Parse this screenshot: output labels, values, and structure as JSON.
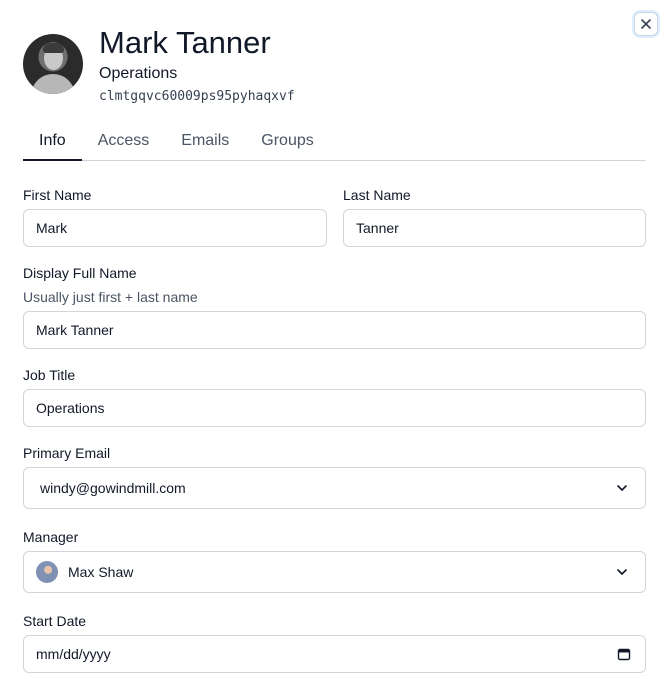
{
  "profile": {
    "name": "Mark Tanner",
    "title": "Operations",
    "uid": "clmtgqvc60009ps95pyhaqxvf"
  },
  "tabs": [
    {
      "label": "Info",
      "active": true
    },
    {
      "label": "Access",
      "active": false
    },
    {
      "label": "Emails",
      "active": false
    },
    {
      "label": "Groups",
      "active": false
    }
  ],
  "form": {
    "first_name": {
      "label": "First Name",
      "value": "Mark"
    },
    "last_name": {
      "label": "Last Name",
      "value": "Tanner"
    },
    "display_name": {
      "label": "Display Full Name",
      "help": "Usually just first + last name",
      "value": "Mark Tanner"
    },
    "job_title": {
      "label": "Job Title",
      "value": "Operations"
    },
    "primary_email": {
      "label": "Primary Email",
      "value": "windy@gowindmill.com"
    },
    "manager": {
      "label": "Manager",
      "value": "Max Shaw"
    },
    "start_date": {
      "label": "Start Date",
      "placeholder": "mm/dd/yyyy"
    }
  },
  "icons": {
    "close": "close-icon",
    "chevron": "chevron-down-icon",
    "calendar": "calendar-icon"
  },
  "colors": {
    "focus_ring": "#e0ecff",
    "border": "#d1d5db",
    "text": "#111827"
  }
}
